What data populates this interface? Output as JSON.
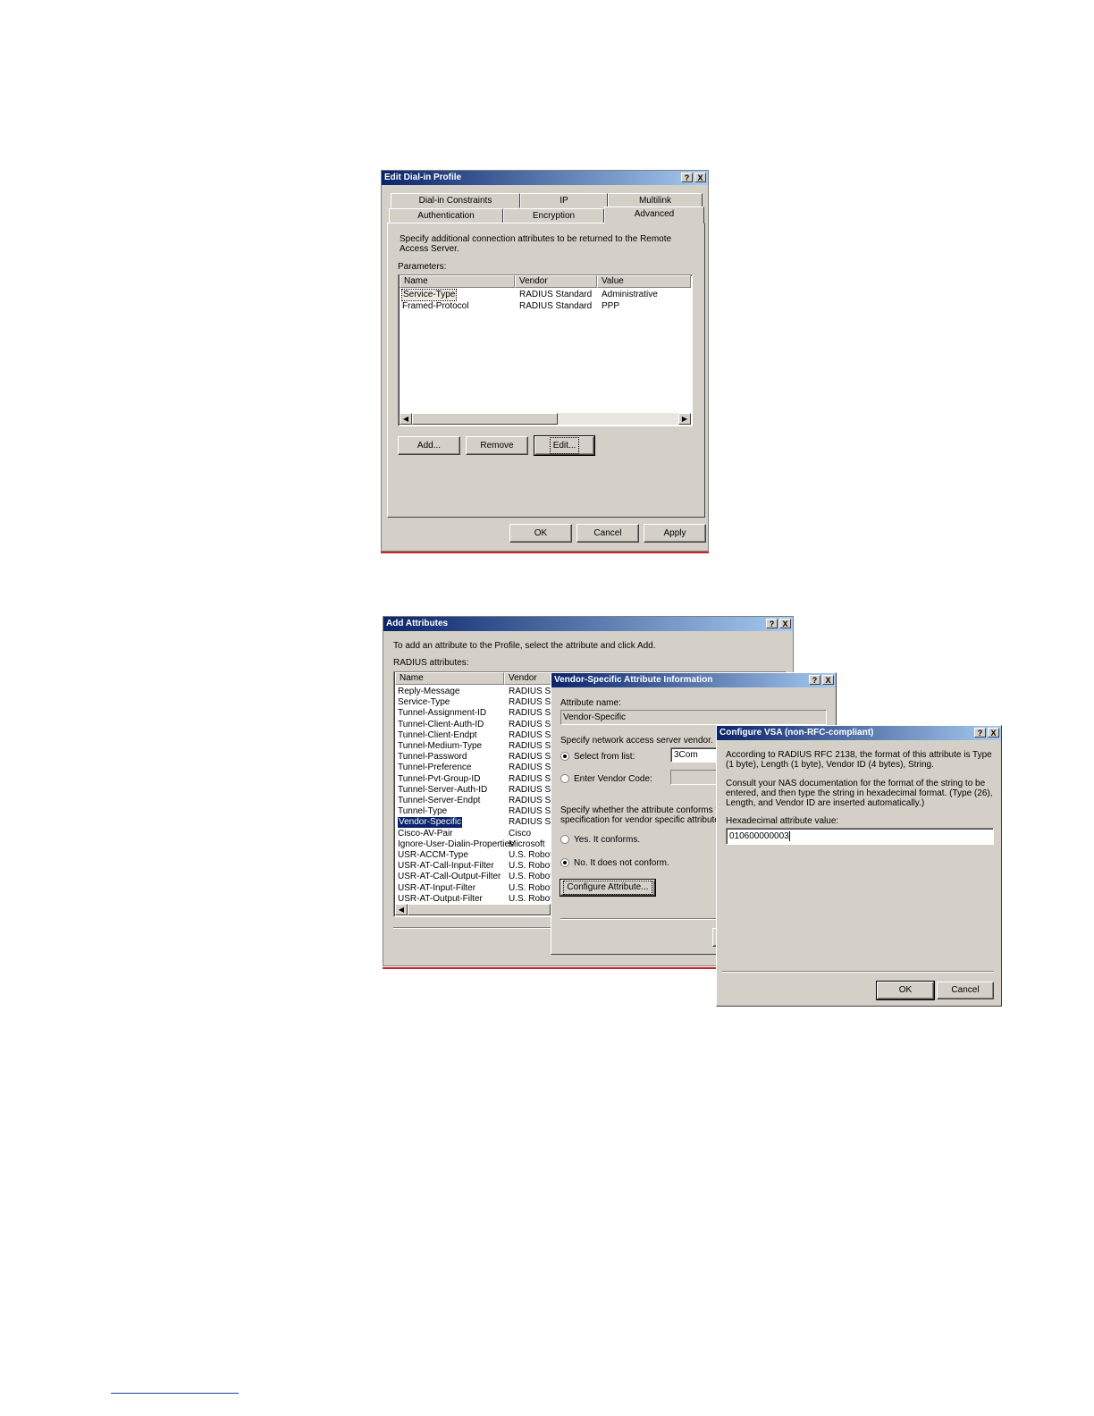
{
  "edit_dialin": {
    "title": "Edit Dial-in Profile",
    "help": "?",
    "close": "X",
    "tabs_back": [
      "Dial-in Constraints",
      "IP",
      "Multilink"
    ],
    "tabs_front": [
      "Authentication",
      "Encryption",
      "Advanced"
    ],
    "description": "Specify additional connection attributes to be returned to the Remote Access Server.",
    "parameters_label": "Parameters:",
    "columns": [
      "Name",
      "Vendor",
      "Value"
    ],
    "rows": [
      {
        "name": "Service-Type",
        "vendor": "RADIUS Standard",
        "value": "Administrative"
      },
      {
        "name": "Framed-Protocol",
        "vendor": "RADIUS Standard",
        "value": "PPP"
      }
    ],
    "add": "Add...",
    "remove": "Remove",
    "edit": "Edit...",
    "ok": "OK",
    "cancel": "Cancel",
    "apply": "Apply"
  },
  "add_attributes": {
    "title": "Add Attributes",
    "help": "?",
    "close": "X",
    "instruction": "To add an attribute to the Profile, select the attribute and click Add.",
    "radius_label": "RADIUS attributes:",
    "columns": [
      "Name",
      "Vendor"
    ],
    "rows": [
      {
        "name": "Reply-Message",
        "vendor": "RADIUS St"
      },
      {
        "name": "Service-Type",
        "vendor": "RADIUS St"
      },
      {
        "name": "Tunnel-Assignment-ID",
        "vendor": "RADIUS St"
      },
      {
        "name": "Tunnel-Client-Auth-ID",
        "vendor": "RADIUS St"
      },
      {
        "name": "Tunnel-Client-Endpt",
        "vendor": "RADIUS St"
      },
      {
        "name": "Tunnel-Medium-Type",
        "vendor": "RADIUS St"
      },
      {
        "name": "Tunnel-Password",
        "vendor": "RADIUS St"
      },
      {
        "name": "Tunnel-Preference",
        "vendor": "RADIUS St"
      },
      {
        "name": "Tunnel-Pvt-Group-ID",
        "vendor": "RADIUS St"
      },
      {
        "name": "Tunnel-Server-Auth-ID",
        "vendor": "RADIUS St"
      },
      {
        "name": "Tunnel-Server-Endpt",
        "vendor": "RADIUS St"
      },
      {
        "name": "Tunnel-Type",
        "vendor": "RADIUS St"
      },
      {
        "name": "Vendor-Specific",
        "vendor": "RADIUS St"
      },
      {
        "name": "Cisco-AV-Pair",
        "vendor": "Cisco"
      },
      {
        "name": "Ignore-User-Dialin-Properties",
        "vendor": "Microsoft"
      },
      {
        "name": "USR-ACCM-Type",
        "vendor": "U.S. Robot"
      },
      {
        "name": "USR-AT-Call-Input-Filter",
        "vendor": "U.S. Robot"
      },
      {
        "name": "USR-AT-Call-Output-Filter",
        "vendor": "U.S. Robot"
      },
      {
        "name": "USR-AT-Input-Filter",
        "vendor": "U.S. Robot"
      },
      {
        "name": "USR-AT-Output-Filter",
        "vendor": "U.S. Robot"
      }
    ],
    "selected_row": "Vendor-Specific"
  },
  "vsa_info": {
    "title": "Vendor-Specific Attribute Information",
    "help": "?",
    "close": "X",
    "attribute_name_label": "Attribute name:",
    "attribute_name_value": "Vendor-Specific",
    "vendor_label": "Specify network access server vendor.",
    "select_from_list": "Select from list:",
    "vendor_selected": "3Com",
    "enter_vendor_code": "Enter Vendor Code:",
    "conform_label": "Specify whether the attribute conforms to the RADIUS RFC specification for vendor specific attributes.",
    "yes": "Yes. It conforms.",
    "no": "No. It does not conform.",
    "configure": "Configure Attribute..."
  },
  "configure_vsa": {
    "title": "Configure VSA (non-RFC-compliant)",
    "help": "?",
    "close": "X",
    "text1": "According to RADIUS RFC 2138, the format of this attribute is Type (1 byte), Length (1 byte), Vendor ID (4 bytes), String.",
    "text2": "Consult your NAS documentation for the format of the string to be entered, and then type the string in hexadecimal format. (Type (26), Length, and Vendor ID are inserted automatically.)",
    "hex_label": "Hexadecimal attribute value:",
    "hex_value": "010600000003",
    "ok": "OK",
    "cancel": "Cancel"
  },
  "colors": {
    "title_start": "#0a246a",
    "title_end": "#a6caf0",
    "face": "#d4d0c8",
    "rule": "#c0282d"
  }
}
